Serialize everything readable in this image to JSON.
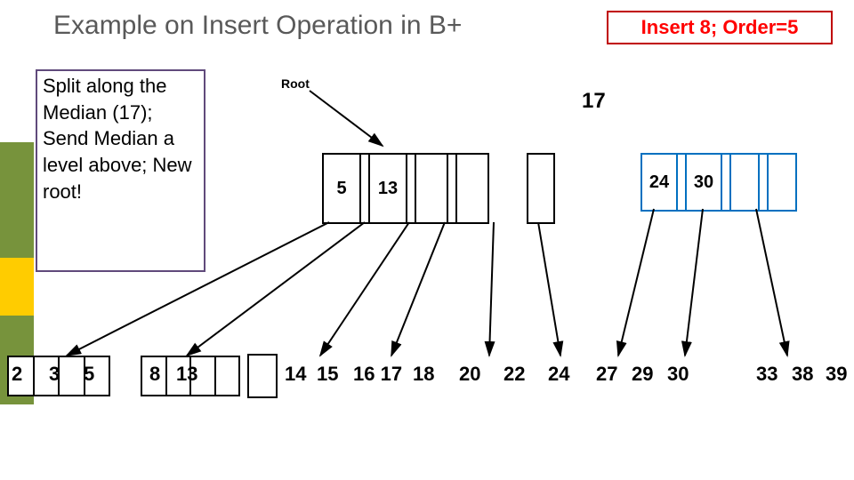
{
  "title": "Example on Insert Operation in B+",
  "badge": "Insert 8; Order=5",
  "annotation": "Split along the Median (17); Send Median a level above; New root!",
  "root_label": "Root",
  "root_key": "17",
  "internal_left": {
    "cells": [
      "5",
      "",
      "13",
      "",
      "",
      "",
      ""
    ]
  },
  "internal_right": {
    "cells": [
      "24",
      "",
      "30",
      "",
      "",
      "",
      ""
    ]
  },
  "leaves": {
    "g1": "2",
    "g2": "3",
    "g3": "5",
    "g4": "8",
    "g5": "13",
    "g6a": "14",
    "g6b": "15",
    "g7": "16 17",
    "g8": "18",
    "g9": "20",
    "g10": "22",
    "g11": "24",
    "g12": "27",
    "g13": "29",
    "g14": "30",
    "g15": "33",
    "g16": "38",
    "g17": "39"
  }
}
